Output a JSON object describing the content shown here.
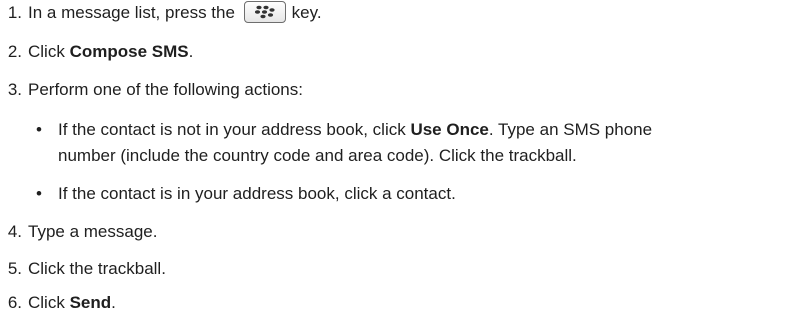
{
  "steps": [
    {
      "num": "1.",
      "before": "In a message list, press the",
      "key_icon": "blackberry-menu-key-icon",
      "after": "key."
    },
    {
      "num": "2.",
      "before": "Click ",
      "bold": "Compose SMS",
      "after": "."
    },
    {
      "num": "3.",
      "text": "Perform one of the following actions:"
    },
    {
      "num": "4.",
      "text": "Type a message."
    },
    {
      "num": "5.",
      "text": "Click the trackball."
    },
    {
      "num": "6.",
      "before": "Click ",
      "bold": "Send",
      "after": "."
    }
  ],
  "bullets": [
    {
      "dot": "•",
      "before": "If the contact is not in your address book, click ",
      "bold": "Use Once",
      "after": ". Type an SMS phone",
      "line2": "number (include the country code and area code). Click the trackball."
    },
    {
      "dot": "•",
      "text": "If the contact is in your address book, click a contact."
    }
  ]
}
